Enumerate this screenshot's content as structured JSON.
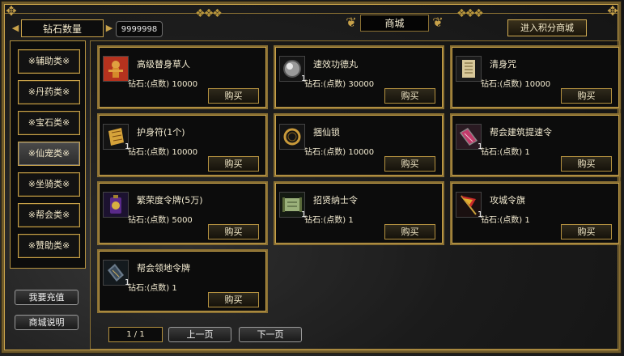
{
  "header": {
    "diamond_label": "钻石数量",
    "diamond_count": "9999998",
    "title": "商城",
    "points_shop_button": "进入积分商城"
  },
  "sidebar": {
    "categories": [
      {
        "label": "※辅助类※",
        "active": false
      },
      {
        "label": "※丹药类※",
        "active": false
      },
      {
        "label": "※宝石类※",
        "active": false
      },
      {
        "label": "※仙宠类※",
        "active": true
      },
      {
        "label": "※坐骑类※",
        "active": false
      },
      {
        "label": "※帮会类※",
        "active": false
      },
      {
        "label": "※赞助类※",
        "active": false
      }
    ],
    "recharge_button": "我要充值",
    "help_button": "商城说明"
  },
  "items": [
    {
      "name": "高级替身草人",
      "price": "钻石:(点数) 10000",
      "qty": "",
      "buy": "购买",
      "icon": "straw-doll-icon"
    },
    {
      "name": "速效功德丸",
      "price": "钻石:(点数) 30000",
      "qty": "1",
      "buy": "购买",
      "icon": "pill-icon"
    },
    {
      "name": "清身咒",
      "price": "钻石:(点数) 10000",
      "qty": "",
      "buy": "购买",
      "icon": "scroll-icon"
    },
    {
      "name": "护身符(1个)",
      "price": "钻石:(点数) 10000",
      "qty": "1",
      "buy": "购买",
      "icon": "talisman-icon"
    },
    {
      "name": "捆仙锁",
      "price": "钻石:(点数) 10000",
      "qty": "",
      "buy": "购买",
      "icon": "ring-lock-icon"
    },
    {
      "name": "帮会建筑提速令",
      "price": "钻石:(点数) 1",
      "qty": "1",
      "buy": "购买",
      "icon": "token-icon"
    },
    {
      "name": "繁荣度令牌(5万)",
      "price": "钻石:(点数) 5000",
      "qty": "",
      "buy": "购买",
      "icon": "pouch-icon"
    },
    {
      "name": "招贤纳士令",
      "price": "钻石:(点数) 1",
      "qty": "1",
      "buy": "购买",
      "icon": "edict-icon"
    },
    {
      "name": "攻城令旗",
      "price": "钻石:(点数) 1",
      "qty": "1",
      "buy": "购买",
      "icon": "flag-icon"
    },
    {
      "name": "帮会领地令牌",
      "price": "钻石:(点数) 1",
      "qty": "1",
      "buy": "购买",
      "icon": "territory-token-icon"
    }
  ],
  "pagination": {
    "indicator": "1 / 1",
    "prev": "上一页",
    "next": "下一页"
  }
}
